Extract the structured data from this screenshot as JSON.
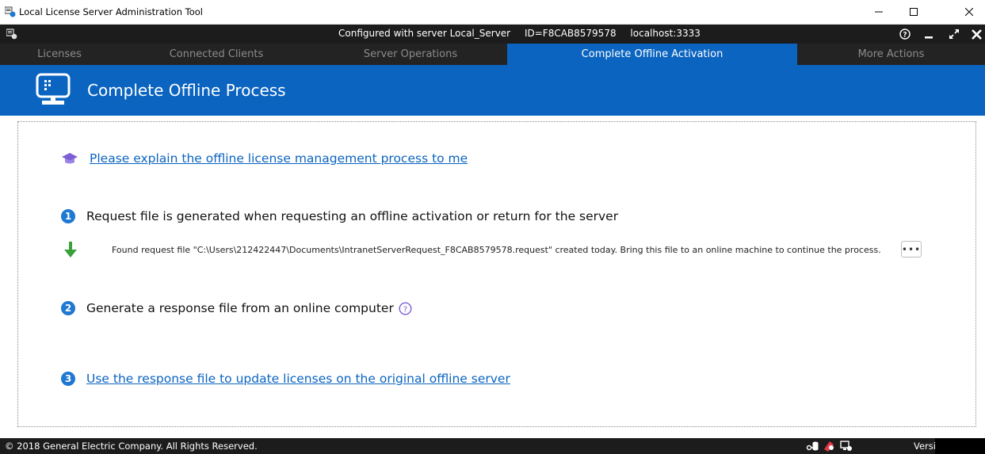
{
  "window": {
    "title": "Local License Server Administration Tool"
  },
  "header": {
    "configured_with": "Configured with server Local_Server",
    "server_id": "ID=F8CAB8579578",
    "host": "localhost:3333"
  },
  "tabs": [
    {
      "label": "Licenses",
      "active": false
    },
    {
      "label": "Connected Clients",
      "active": false
    },
    {
      "label": "Server Operations",
      "active": false
    },
    {
      "label": "Complete Offline Activation",
      "active": true
    },
    {
      "label": "More Actions",
      "active": false
    }
  ],
  "page": {
    "title": "Complete Offline Process"
  },
  "content": {
    "explain_link": "Please explain the offline license management process to me",
    "step1": {
      "number": "1",
      "text": "Request file is generated when requesting an offline activation or return for the server"
    },
    "found_request": "Found request file \"C:\\Users\\212422447\\Documents\\IntranetServerRequest_F8CAB8579578.request\" created today. Bring this file to an online machine to continue the process.",
    "more_button": "•••",
    "step2": {
      "number": "2",
      "text": "Generate a response file from an online computer"
    },
    "step3": {
      "number": "3",
      "link": "Use the response file to update licenses on the original offline server"
    }
  },
  "statusbar": {
    "copyright": "© 2018 General Electric Company.  All Rights Reserved.",
    "version_label": "Version:"
  },
  "colors": {
    "accent": "#0b64c0",
    "header_bg": "#1c1c1c",
    "tab_bg": "#232323",
    "success_green": "#3aa13a",
    "badge_blue": "#1f78d1",
    "purple_icon": "#7c5fd6"
  }
}
